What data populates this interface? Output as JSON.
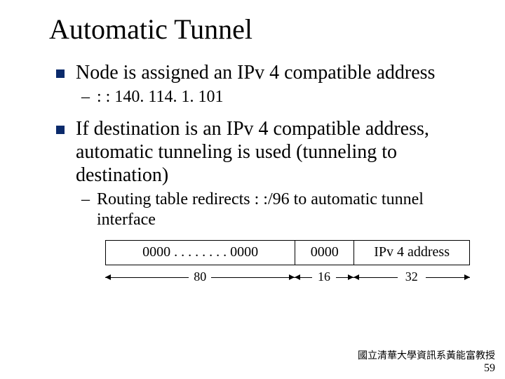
{
  "title": "Automatic Tunnel",
  "bullets": [
    {
      "text": "Node is assigned an IPv 4 compatible address",
      "sub": [
        ": : 140. 114. 1. 101"
      ]
    },
    {
      "text": "If destination is an IPv 4 compatible address, automatic tunneling is used (tunneling to destination)",
      "sub": [
        "Routing table redirects : :/96 to automatic tunnel interface"
      ]
    }
  ],
  "diagram": {
    "cells": [
      "0000 . . . . . . . . 0000",
      "0000",
      "IPv 4 address"
    ],
    "widths": [
      "80",
      "16",
      "32"
    ]
  },
  "footer": {
    "org": "國立清華大學資訊系黃能富教授",
    "page": "59"
  }
}
